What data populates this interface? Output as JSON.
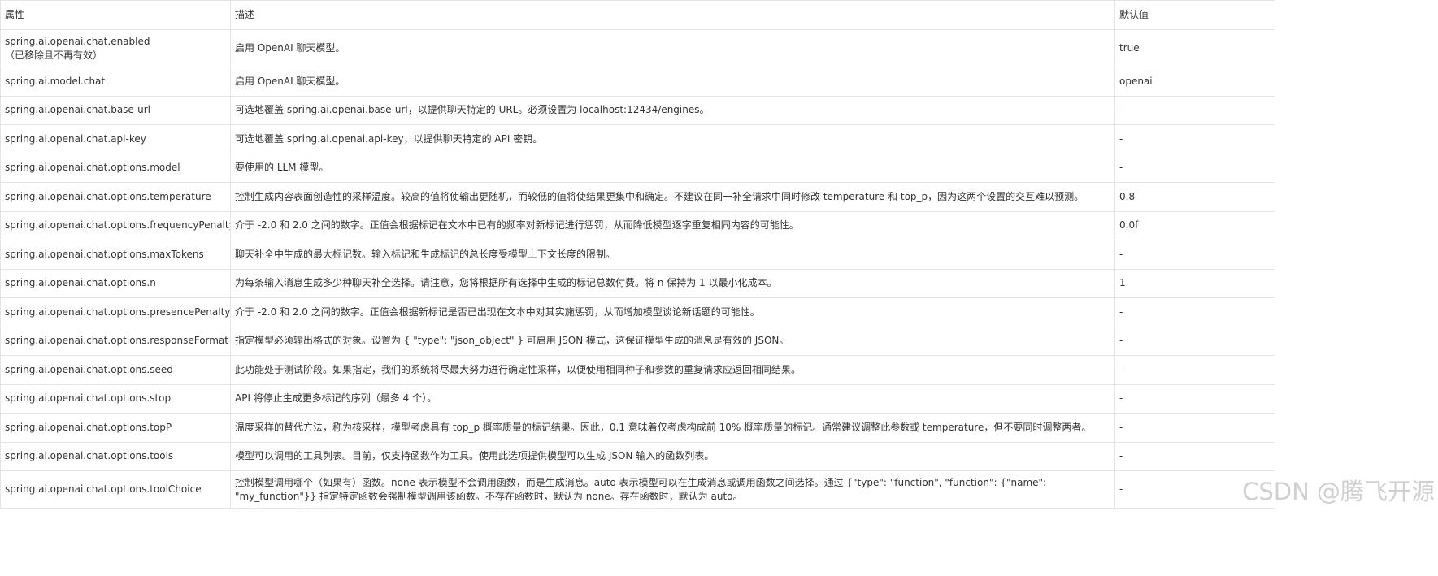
{
  "table": {
    "headers": {
      "property": "属性",
      "description": "描述",
      "default": "默认值"
    },
    "rows": [
      {
        "property": "spring.ai.openai.chat.enabled",
        "note": "（已移除且不再有效）",
        "description": "启用 OpenAI 聊天模型。",
        "default": "true"
      },
      {
        "property": "spring.ai.model.chat",
        "description": "启用 OpenAI 聊天模型。",
        "default": "openai"
      },
      {
        "property": "spring.ai.openai.chat.base-url",
        "description": "可选地覆盖 spring.ai.openai.base-url，以提供聊天特定的 URL。必须设置为 localhost:12434/engines。",
        "default": "-"
      },
      {
        "property": "spring.ai.openai.chat.api-key",
        "description": "可选地覆盖 spring.ai.openai.api-key，以提供聊天特定的 API 密钥。",
        "default": "-"
      },
      {
        "property": "spring.ai.openai.chat.options.model",
        "description": "要使用的 LLM 模型。",
        "default": "-"
      },
      {
        "property": "spring.ai.openai.chat.options.temperature",
        "description": "控制生成内容表面创造性的采样温度。较高的值将使输出更随机，而较低的值将使结果更集中和确定。不建议在同一补全请求中同时修改 temperature 和 top_p，因为这两个设置的交互难以预测。",
        "default": "0.8"
      },
      {
        "property": "spring.ai.openai.chat.options.frequencyPenalty",
        "description": "介于 -2.0 和 2.0 之间的数字。正值会根据标记在文本中已有的频率对新标记进行惩罚，从而降低模型逐字重复相同内容的可能性。",
        "default": "0.0f"
      },
      {
        "property": "spring.ai.openai.chat.options.maxTokens",
        "description": "聊天补全中生成的最大标记数。输入标记和生成标记的总长度受模型上下文长度的限制。",
        "default": "-"
      },
      {
        "property": "spring.ai.openai.chat.options.n",
        "description": "为每条输入消息生成多少种聊天补全选择。请注意，您将根据所有选择中生成的标记总数付费。将 n 保持为 1 以最小化成本。",
        "default": "1"
      },
      {
        "property": "spring.ai.openai.chat.options.presencePenalty",
        "description": "介于 -2.0 和 2.0 之间的数字。正值会根据新标记是否已出现在文本中对其实施惩罚，从而增加模型谈论新话题的可能性。",
        "default": "-"
      },
      {
        "property": "spring.ai.openai.chat.options.responseFormat",
        "description": "指定模型必须输出格式的对象。设置为 { \"type\": \"json_object\" } 可启用 JSON 模式，这保证模型生成的消息是有效的 JSON。",
        "default": "-"
      },
      {
        "property": "spring.ai.openai.chat.options.seed",
        "description": "此功能处于测试阶段。如果指定，我们的系统将尽最大努力进行确定性采样，以便使用相同种子和参数的重复请求应返回相同结果。",
        "default": "-"
      },
      {
        "property": "spring.ai.openai.chat.options.stop",
        "description": "API 将停止生成更多标记的序列（最多 4 个）。",
        "default": "-"
      },
      {
        "property": "spring.ai.openai.chat.options.topP",
        "description": "温度采样的替代方法，称为核采样，模型考虑具有 top_p 概率质量的标记结果。因此，0.1 意味着仅考虑构成前 10% 概率质量的标记。通常建议调整此参数或 temperature，但不要同时调整两者。",
        "default": "-"
      },
      {
        "property": "spring.ai.openai.chat.options.tools",
        "description": "模型可以调用的工具列表。目前，仅支持函数作为工具。使用此选项提供模型可以生成 JSON 输入的函数列表。",
        "default": "-"
      },
      {
        "property": "spring.ai.openai.chat.options.toolChoice",
        "description": "控制模型调用哪个（如果有）函数。none 表示模型不会调用函数，而是生成消息。auto 表示模型可以在生成消息或调用函数之间选择。通过 {\"type\": \"function\", \"function\": {\"name\": \"my_function\"}} 指定特定函数会强制模型调用该函数。不存在函数时，默认为 none。存在函数时，默认为 auto。",
        "default": "-"
      }
    ]
  },
  "watermark": "CSDN @腾飞开源"
}
